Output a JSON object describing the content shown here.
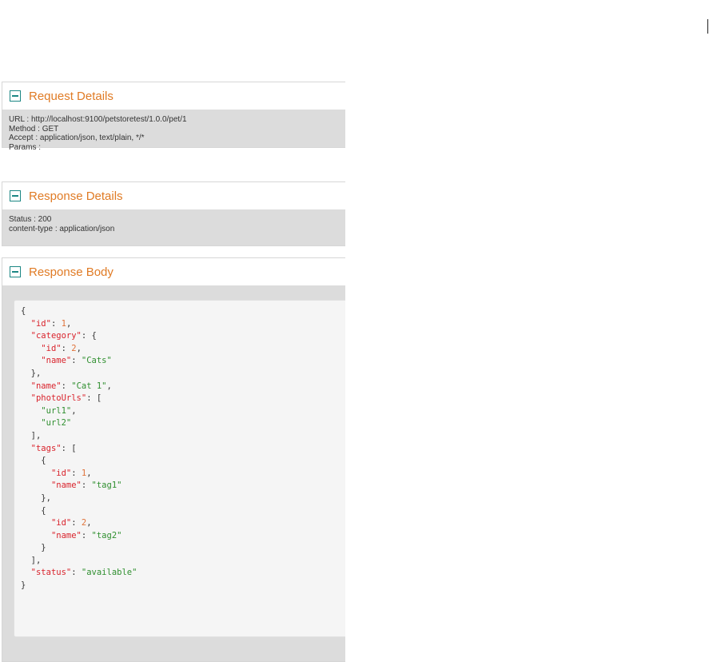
{
  "colors": {
    "accent": "#e07b25",
    "toggle": "#1c8784",
    "key": "#d9232c",
    "number": "#e0733a",
    "string": "#2f8f2f"
  },
  "request": {
    "title": "Request Details",
    "url": "URL : http://localhost:9100/petstoretest/1.0.0/pet/1",
    "method": "Method : GET",
    "accept": "Accept : application/json, text/plain, */*",
    "params": "Params :"
  },
  "response": {
    "title": "Response Details",
    "status": "Status : 200",
    "content_type": "content-type : application/json"
  },
  "body": {
    "title": "Response Body",
    "json": {
      "id": 1,
      "category": {
        "id": 2,
        "name": "Cats"
      },
      "name": "Cat 1",
      "photoUrls": [
        "url1",
        "url2"
      ],
      "tags": [
        {
          "id": 1,
          "name": "tag1"
        },
        {
          "id": 2,
          "name": "tag2"
        }
      ],
      "status": "available"
    }
  }
}
